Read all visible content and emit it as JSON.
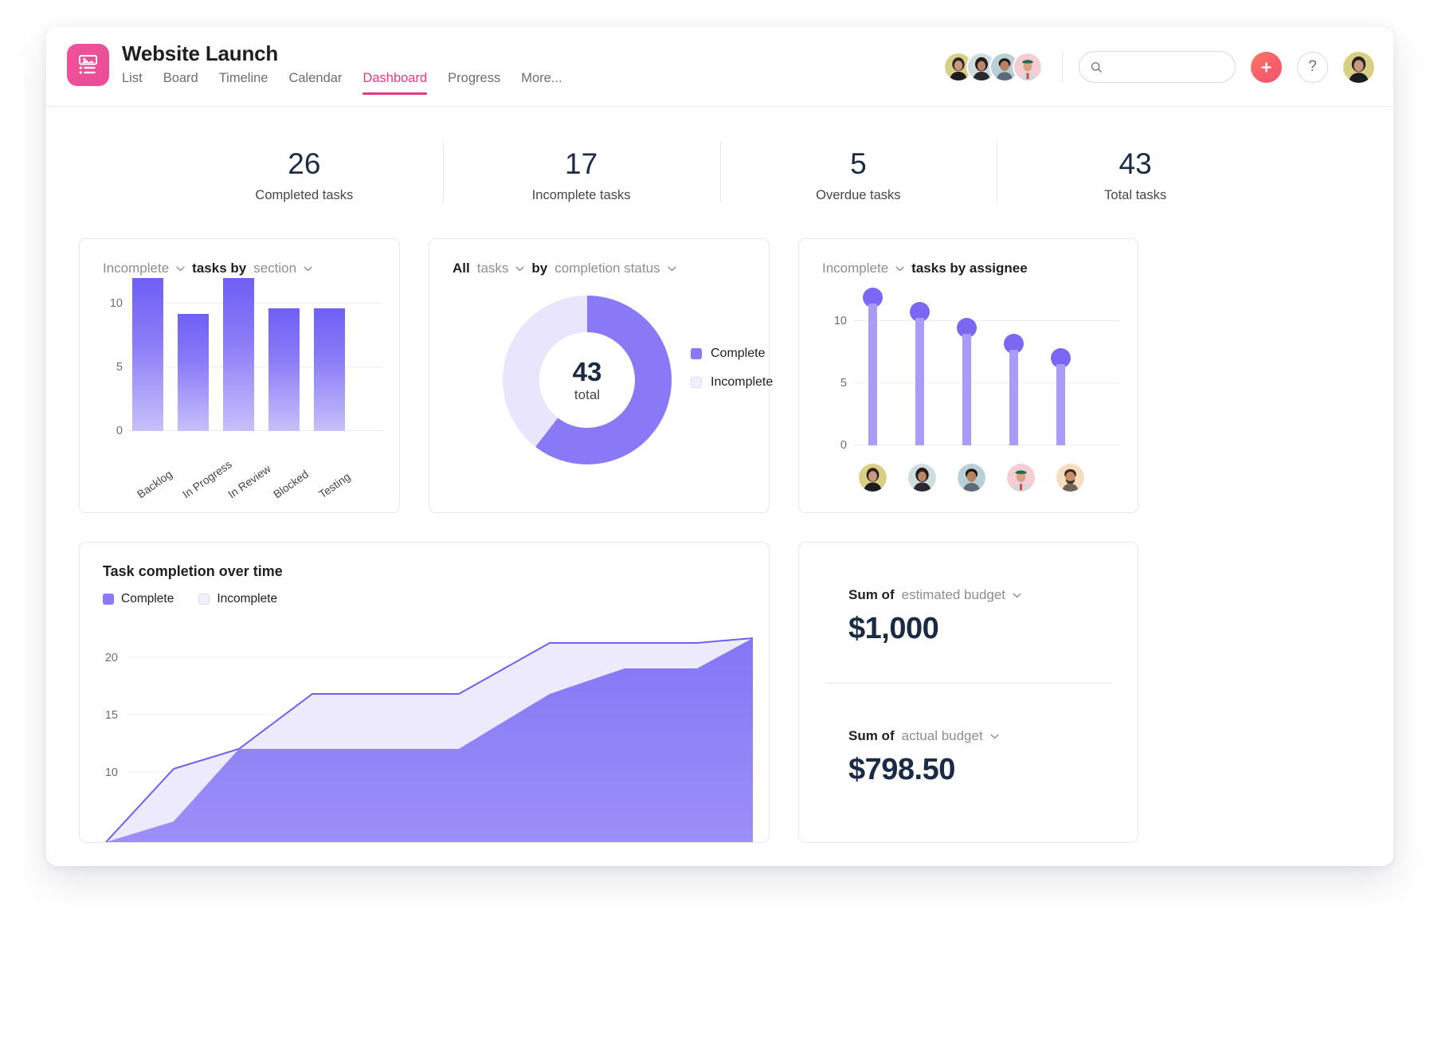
{
  "header": {
    "project_title": "Website Launch",
    "logo_icon": "project-image-list-icon",
    "tabs": [
      {
        "label": "List",
        "active": false
      },
      {
        "label": "Board",
        "active": false
      },
      {
        "label": "Timeline",
        "active": false
      },
      {
        "label": "Calendar",
        "active": false
      },
      {
        "label": "Dashboard",
        "active": true
      },
      {
        "label": "Progress",
        "active": false
      },
      {
        "label": "More...",
        "active": false
      }
    ],
    "search": {
      "value": "",
      "placeholder": "",
      "icon": "search-icon"
    },
    "add_button_icon": "plus-icon",
    "help_button_label": "?",
    "member_avatars": [
      "member-avatar-1",
      "member-avatar-2",
      "member-avatar-3",
      "member-avatar-4"
    ],
    "user_avatar": "current-user-avatar",
    "accent_pink": "#e8387f",
    "logo_pink": "#ea4c96",
    "add_coral": "#f75c6b"
  },
  "stats": [
    {
      "value": "26",
      "label": "Completed tasks"
    },
    {
      "value": "17",
      "label": "Incomplete tasks"
    },
    {
      "value": "5",
      "label": "Overdue tasks"
    },
    {
      "value": "43",
      "label": "Total tasks"
    }
  ],
  "card_section": {
    "filter": "Incomplete",
    "mid": "tasks by",
    "group": "section"
  },
  "card_status": {
    "filter": "All",
    "noun": "tasks",
    "by": "by",
    "group": "completion status",
    "center_value": "43",
    "center_label": "total",
    "legend": [
      {
        "label": "Complete",
        "style": "full"
      },
      {
        "label": "Incomplete",
        "style": "hollow"
      }
    ]
  },
  "card_assignee": {
    "filter": "Incomplete",
    "title": "tasks by assignee"
  },
  "card_over_time": {
    "title": "Task completion over time",
    "legend": [
      {
        "label": "Complete",
        "style": "full"
      },
      {
        "label": "Incomplete",
        "style": "hollow"
      }
    ]
  },
  "card_budget": {
    "rows": [
      {
        "prefix": "Sum of",
        "field": "estimated budget",
        "value": "$1,000"
      },
      {
        "prefix": "Sum of",
        "field": "actual budget",
        "value": "$798.50"
      }
    ]
  },
  "chart_data": [
    {
      "type": "bar",
      "title": "Incomplete tasks by section",
      "categories": [
        "Backlog",
        "In Progress",
        "In Review",
        "Blocked",
        "Testing"
      ],
      "values": [
        12,
        9.2,
        12,
        9.6,
        9.6
      ],
      "xlabel": "",
      "ylabel": "",
      "ylim": [
        0,
        13
      ],
      "yticks": [
        0,
        5,
        10
      ],
      "grid": true,
      "legend": "none",
      "bar_gradient_top": "#6f5ff5",
      "bar_gradient_bottom": "#c7c0fb"
    },
    {
      "type": "pie",
      "title": "All tasks by completion status",
      "subtitle": "43 total",
      "labels": [
        "Complete",
        "Incomplete"
      ],
      "values": [
        26,
        17
      ],
      "total": 43,
      "colors": [
        "#8a79f6",
        "#e9e5fd"
      ],
      "legend": "right",
      "donut": true
    },
    {
      "type": "bar",
      "title": "Incomplete tasks by assignee",
      "categories": [
        "assignee-1",
        "assignee-2",
        "assignee-3",
        "assignee-4",
        "assignee-5"
      ],
      "values": [
        12,
        10.8,
        9.5,
        8.2,
        7
      ],
      "xlabel": "",
      "ylabel": "",
      "ylim": [
        0,
        13
      ],
      "yticks": [
        0,
        5,
        10
      ],
      "grid": true,
      "legend": "none",
      "style": "lollipop",
      "stem_color": "#a99cf8",
      "dot_color": "#7a68f5"
    },
    {
      "type": "area",
      "title": "Task completion over time",
      "x": [
        0,
        1,
        2,
        3,
        4,
        5,
        6,
        7,
        8,
        9
      ],
      "series": [
        {
          "name": "Complete",
          "values": [
            0,
            5.0,
            11.4,
            11.4,
            11.4,
            11.4,
            16.2,
            18.5,
            18.5,
            21.3
          ],
          "color": "#8a79f6"
        },
        {
          "name": "Incomplete",
          "values": [
            0,
            9.6,
            11.4,
            16.2,
            16.2,
            16.2,
            21.3,
            21.3,
            21.3,
            22.3
          ],
          "color": "#eceafc"
        }
      ],
      "ylim": [
        0,
        24
      ],
      "yticks": [
        10,
        15,
        20
      ],
      "grid": true,
      "legend": "top-left",
      "line_color": "#6f5ff5"
    }
  ]
}
